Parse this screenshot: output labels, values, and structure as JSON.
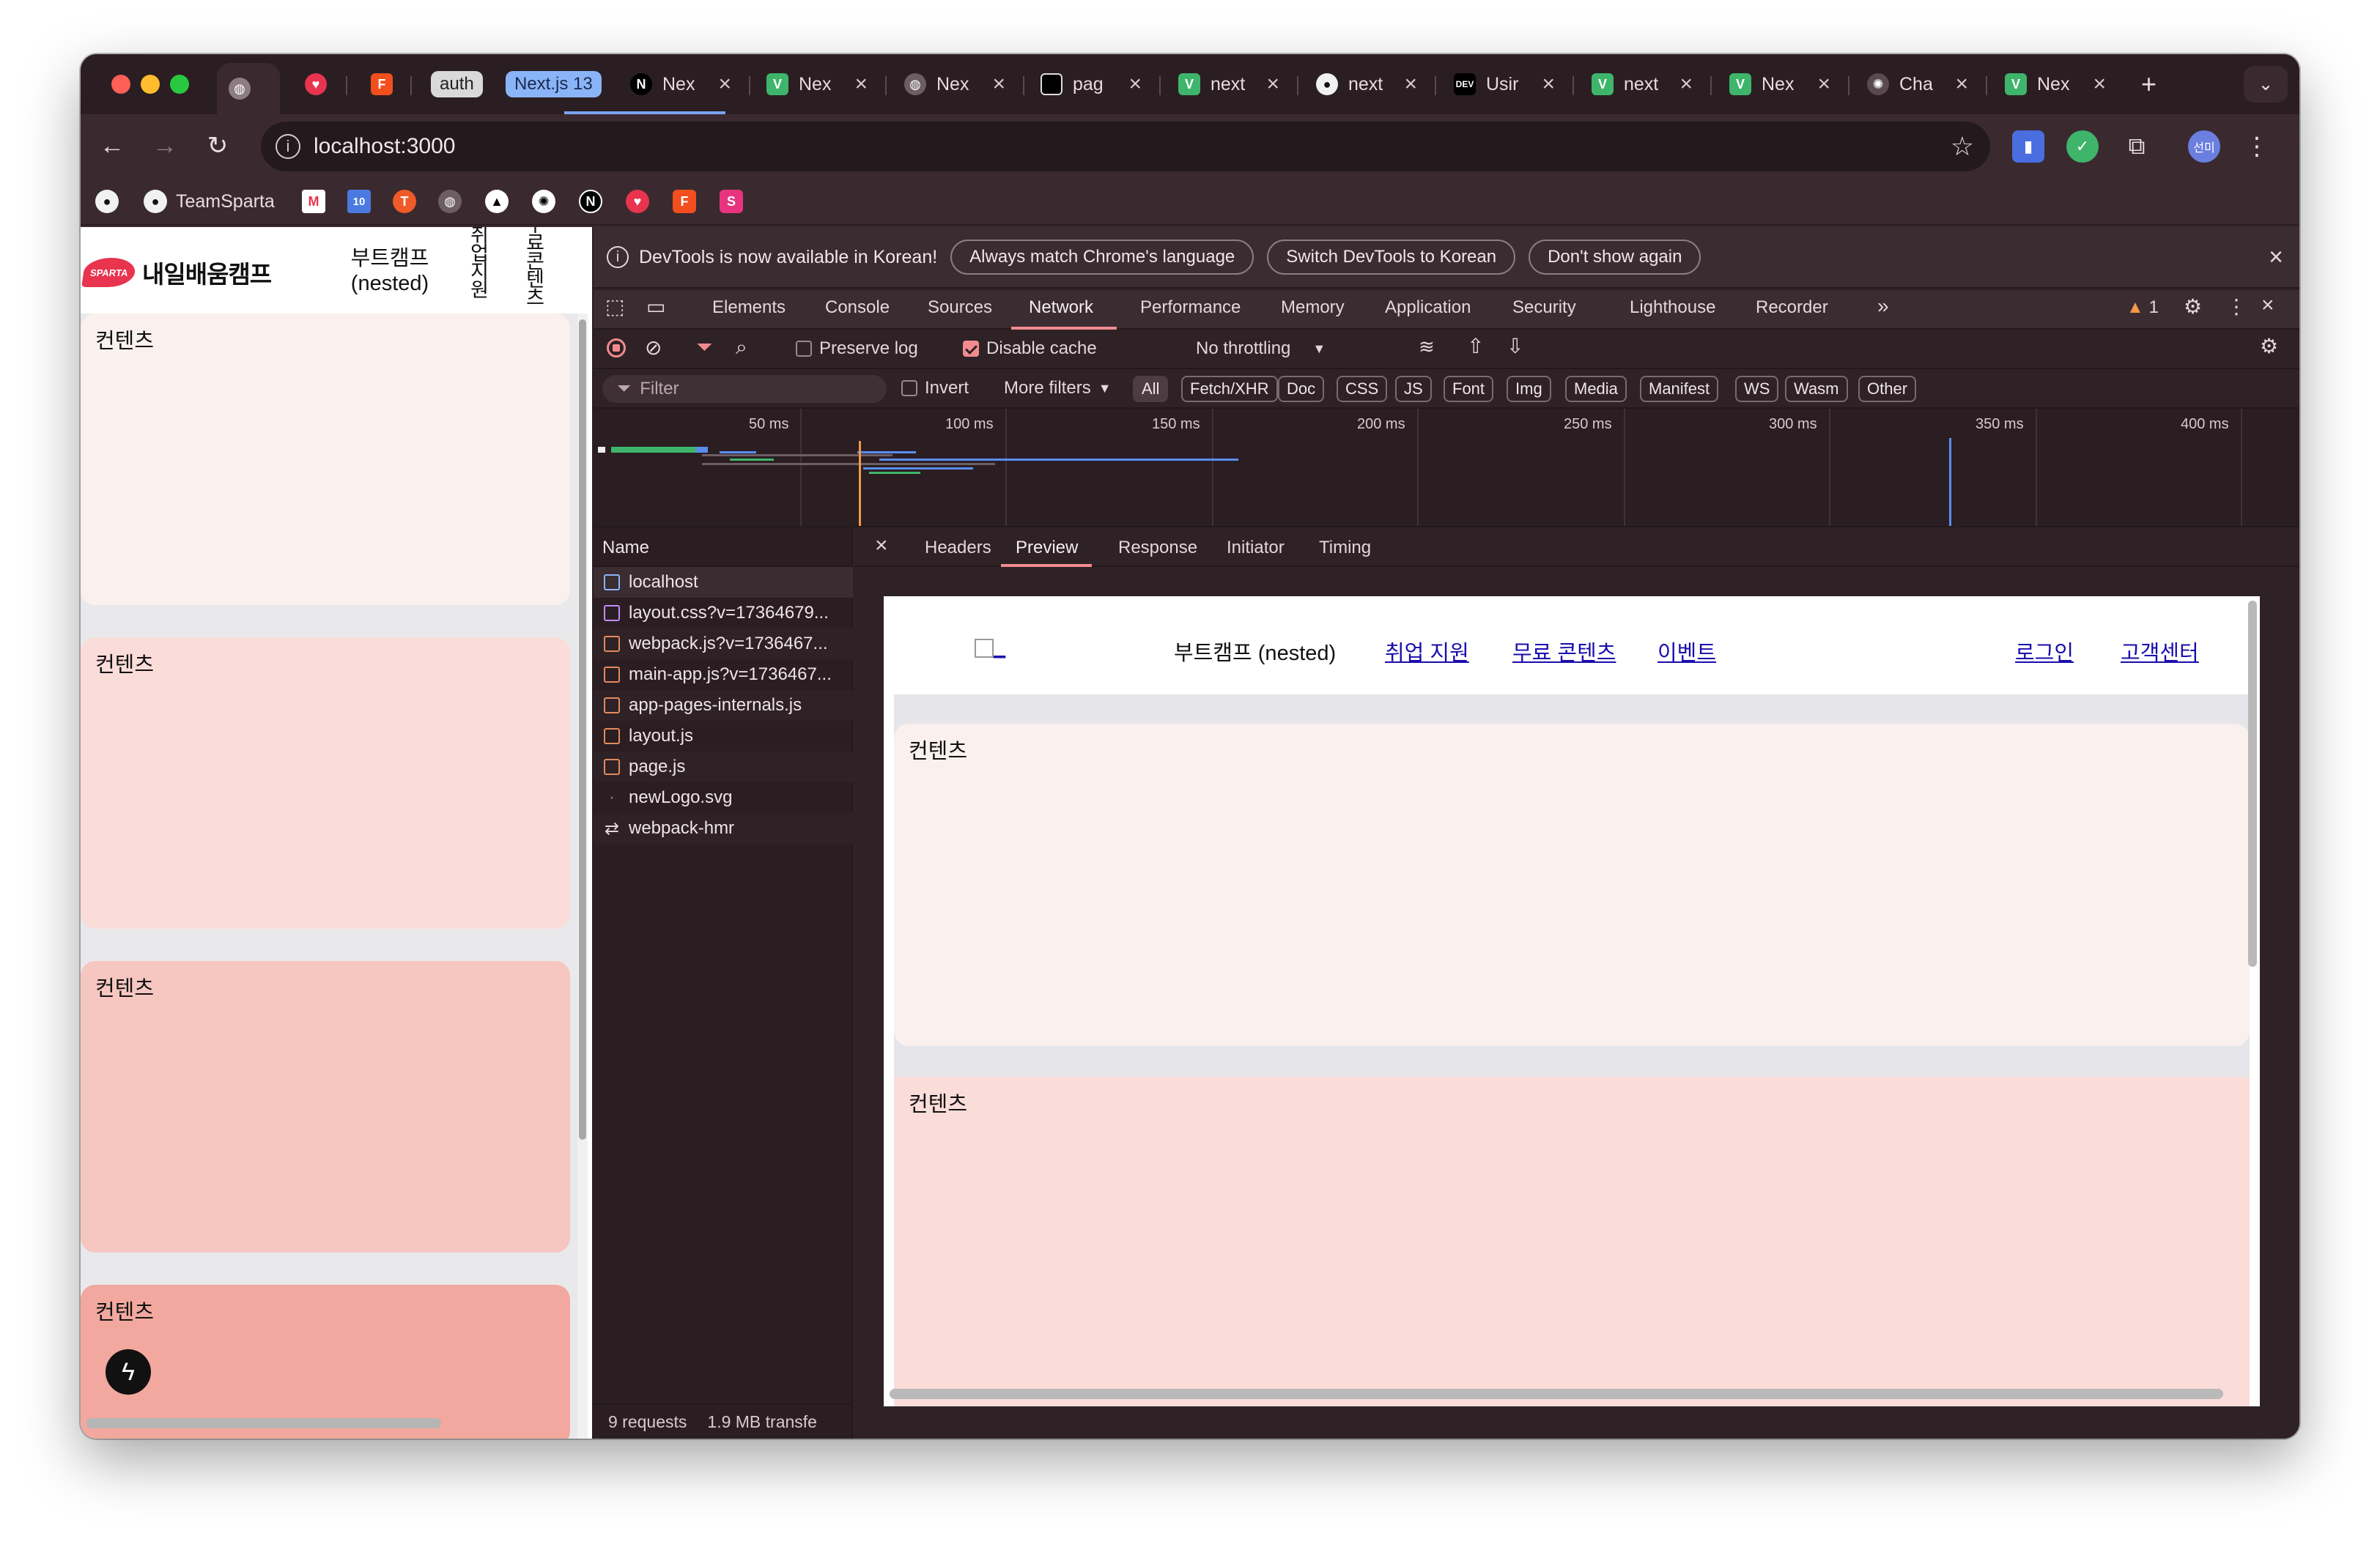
{
  "tabs": {
    "groups": [
      "auth",
      "Next.js 13"
    ],
    "items": [
      "Nex",
      "Nex",
      "Nex",
      "pag",
      "next",
      "next",
      "Usir",
      "next",
      "Nex",
      "Cha",
      "Nex"
    ],
    "new_tab": "+",
    "menu": "⌄"
  },
  "toolbar": {
    "url": "localhost:3000",
    "profile": "선미"
  },
  "bookmarks": {
    "teamsparta": "TeamSparta",
    "calendar_day": "10"
  },
  "page": {
    "brand_badge": "SPARTA",
    "brand": "내일배움캠프",
    "nav_nested_line1": "부트캠프",
    "nav_nested_line2": "(nested)",
    "nav_jobs": "취업지원",
    "nav_free": "무료콘텐츠",
    "cards": [
      "컨텐츠",
      "컨텐츠",
      "컨텐츠",
      "컨텐츠"
    ]
  },
  "devtools": {
    "banner": {
      "message": "DevTools is now available in Korean!",
      "btn_match": "Always match Chrome's language",
      "btn_switch": "Switch DevTools to Korean",
      "btn_dismiss": "Don't show again"
    },
    "tabs": [
      "Elements",
      "Console",
      "Sources",
      "Network",
      "Performance",
      "Memory",
      "Application",
      "Security",
      "Lighthouse",
      "Recorder"
    ],
    "warnings": "1",
    "network": {
      "preserve_log": "Preserve log",
      "disable_cache": "Disable cache",
      "throttling": "No throttling",
      "filter_placeholder": "Filter",
      "invert": "Invert",
      "more_filters": "More filters",
      "type_filters": [
        "All",
        "Fetch/XHR",
        "Doc",
        "CSS",
        "JS",
        "Font",
        "Img",
        "Media",
        "Manifest",
        "WS",
        "Wasm",
        "Other"
      ],
      "timeline_ticks": [
        "50 ms",
        "100 ms",
        "150 ms",
        "200 ms",
        "250 ms",
        "300 ms",
        "350 ms",
        "400 ms"
      ],
      "name_header": "Name",
      "requests": [
        "localhost",
        "layout.css?v=17364679...",
        "webpack.js?v=1736467...",
        "main-app.js?v=1736467...",
        "app-pages-internals.js",
        "layout.js",
        "page.js",
        "newLogo.svg",
        "webpack-hmr"
      ],
      "summary_requests": "9 requests",
      "summary_transfer": "1.9 MB transfe",
      "detail_tabs": [
        "Headers",
        "Preview",
        "Response",
        "Initiator",
        "Timing"
      ]
    },
    "preview": {
      "logo_alt": "_",
      "nav_nested": "부트캠프 (nested)",
      "nav_jobs": "취업 지원",
      "nav_free": "무료 콘텐츠",
      "nav_event": "이벤트",
      "login": "로그인",
      "support": "고객센터",
      "cards": [
        "컨텐츠",
        "컨텐츠"
      ]
    }
  },
  "colors": {
    "card1": "#faf0ed",
    "card2": "#fadcd9",
    "card3": "#f6c6c1",
    "card4": "#f2a89e",
    "accent": "#f28b8f"
  }
}
